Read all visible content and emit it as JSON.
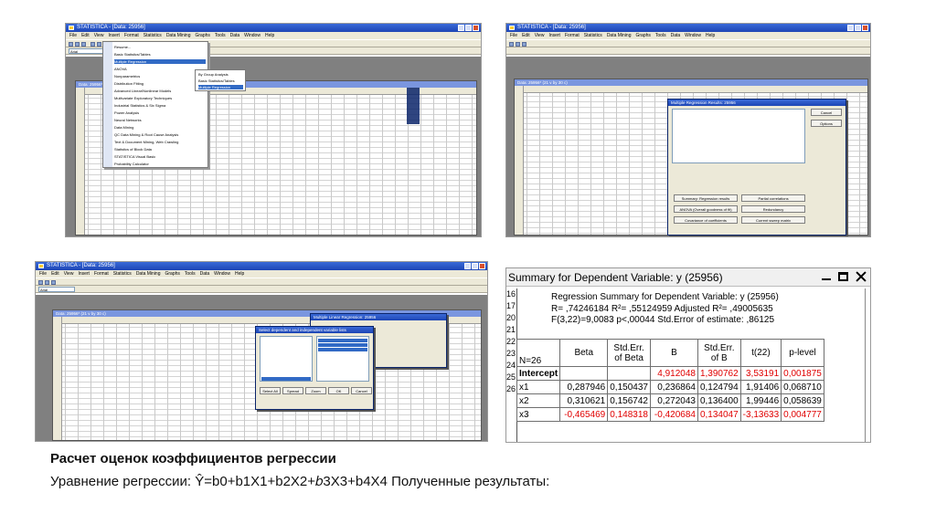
{
  "screenshots": {
    "top_left": {
      "title": "STATISTICA - [Data: 25956]",
      "menu": [
        "File",
        "Edit",
        "View",
        "Insert",
        "Format",
        "Statistics",
        "Data Mining",
        "Graphs",
        "Tools",
        "Data",
        "Window",
        "Help"
      ],
      "font_box": "Arial",
      "child_title": "Data: 25956* (21 v by 30 c)",
      "dropdown": [
        "Resume...",
        "Basic Statistics/Tables",
        "Multiple Regression",
        "ANOVA",
        "Nonparametrics",
        "Distribution Fitting",
        "Advanced Linear/Nonlinear Models",
        "Multivariate Exploratory Techniques",
        "Industrial Statistics & Six Sigma",
        "Power Analysis",
        "Neural Networks",
        "Data Mining",
        "QC Data Mining & Root Cause Analysis",
        "Text & Document Mining, Web Crawling",
        "Statistics of Block Data",
        "STATISTICA Visual Basic",
        "Probability Calculator"
      ],
      "submenu": [
        "By Group Analysis",
        "Basic Statistics/Tables",
        "Multiple Regression"
      ]
    },
    "top_right": {
      "title": "STATISTICA - [Data: 25956]",
      "menu": [
        "File",
        "Edit",
        "View",
        "Insert",
        "Format",
        "Statistics",
        "Data Mining",
        "Graphs",
        "Tools",
        "Data",
        "Window",
        "Help"
      ],
      "child_title": "Data: 25956* (21 v by 30 c)",
      "dialog_title": "Multiple Regression Results: 25956",
      "dialog_buttons": [
        "Summary: Regression results",
        "Partial correlations",
        "ANOVA (Overall goodness of fit)",
        "Redundancy",
        "Covariance of coefficients",
        "Current sweep matrix",
        "Cancel",
        "Options"
      ]
    },
    "bottom_left": {
      "title": "STATISTICA - [Data: 25956]",
      "menu": [
        "File",
        "Edit",
        "View",
        "Insert",
        "Format",
        "Statistics",
        "Data Mining",
        "Graphs",
        "Tools",
        "Data",
        "Window",
        "Help"
      ],
      "font_box": "Arial",
      "child_title": "Data: 25956* (21 v by 30 c)",
      "dialog_title": "Multiple Linear Regression: 25956",
      "subdialog_title": "Select dependent and independent variable lists",
      "subdialog_buttons": [
        "Select All",
        "Spread",
        "Zoom",
        "OK",
        "Cancel"
      ]
    },
    "bottom_right": {
      "title": "Summary for Dependent Variable: y (25956)",
      "row_numbers": [
        "16",
        "17",
        "20",
        "21",
        "22",
        "23",
        "24",
        "25",
        "26"
      ],
      "header_lines": [
        "Regression Summary for Dependent Variable: y (25956)",
        "R= ,74246184 R²= ,55124959 Adjusted R²= ,49005635",
        "F(3,22)=9,0083 p<,00044 Std.Error of estimate: ,86125"
      ],
      "n_label": "N=26",
      "columns": [
        "Beta",
        "Std.Err.\nof Beta",
        "B",
        "Std.Err.\nof B",
        "t(22)",
        "p-level"
      ],
      "rows": [
        {
          "label": "Intercept",
          "cells": [
            "",
            "",
            "4,912048",
            "1,390762",
            "3,53191",
            "0,001875"
          ],
          "red": true,
          "bold": true
        },
        {
          "label": "x1",
          "cells": [
            "0,287946",
            "0,150437",
            "0,236864",
            "0,124794",
            "1,91406",
            "0,068710"
          ],
          "red": false,
          "bold": false
        },
        {
          "label": "x2",
          "cells": [
            "0,310621",
            "0,156742",
            "0,272043",
            "0,136400",
            "1,99446",
            "0,058639"
          ],
          "red": false,
          "bold": false
        },
        {
          "label": "x3",
          "cells": [
            "-0,465469",
            "0,148318",
            "-0,420684",
            "0,134047",
            "-3,13633",
            "0,004777"
          ],
          "red": true,
          "bold": false
        }
      ]
    }
  },
  "caption": {
    "heading": "Расчет оценок коэффициентов регрессии",
    "line": "Уравнение регрессии: Ŷ=b0+b1X1+b2X2+𝑏3X3+b4X4 Полученные результаты:"
  },
  "colors": {
    "highlight_red": "#e00000",
    "xp_title_blue": "#1d45b5",
    "menu_highlight": "#316ac5"
  }
}
